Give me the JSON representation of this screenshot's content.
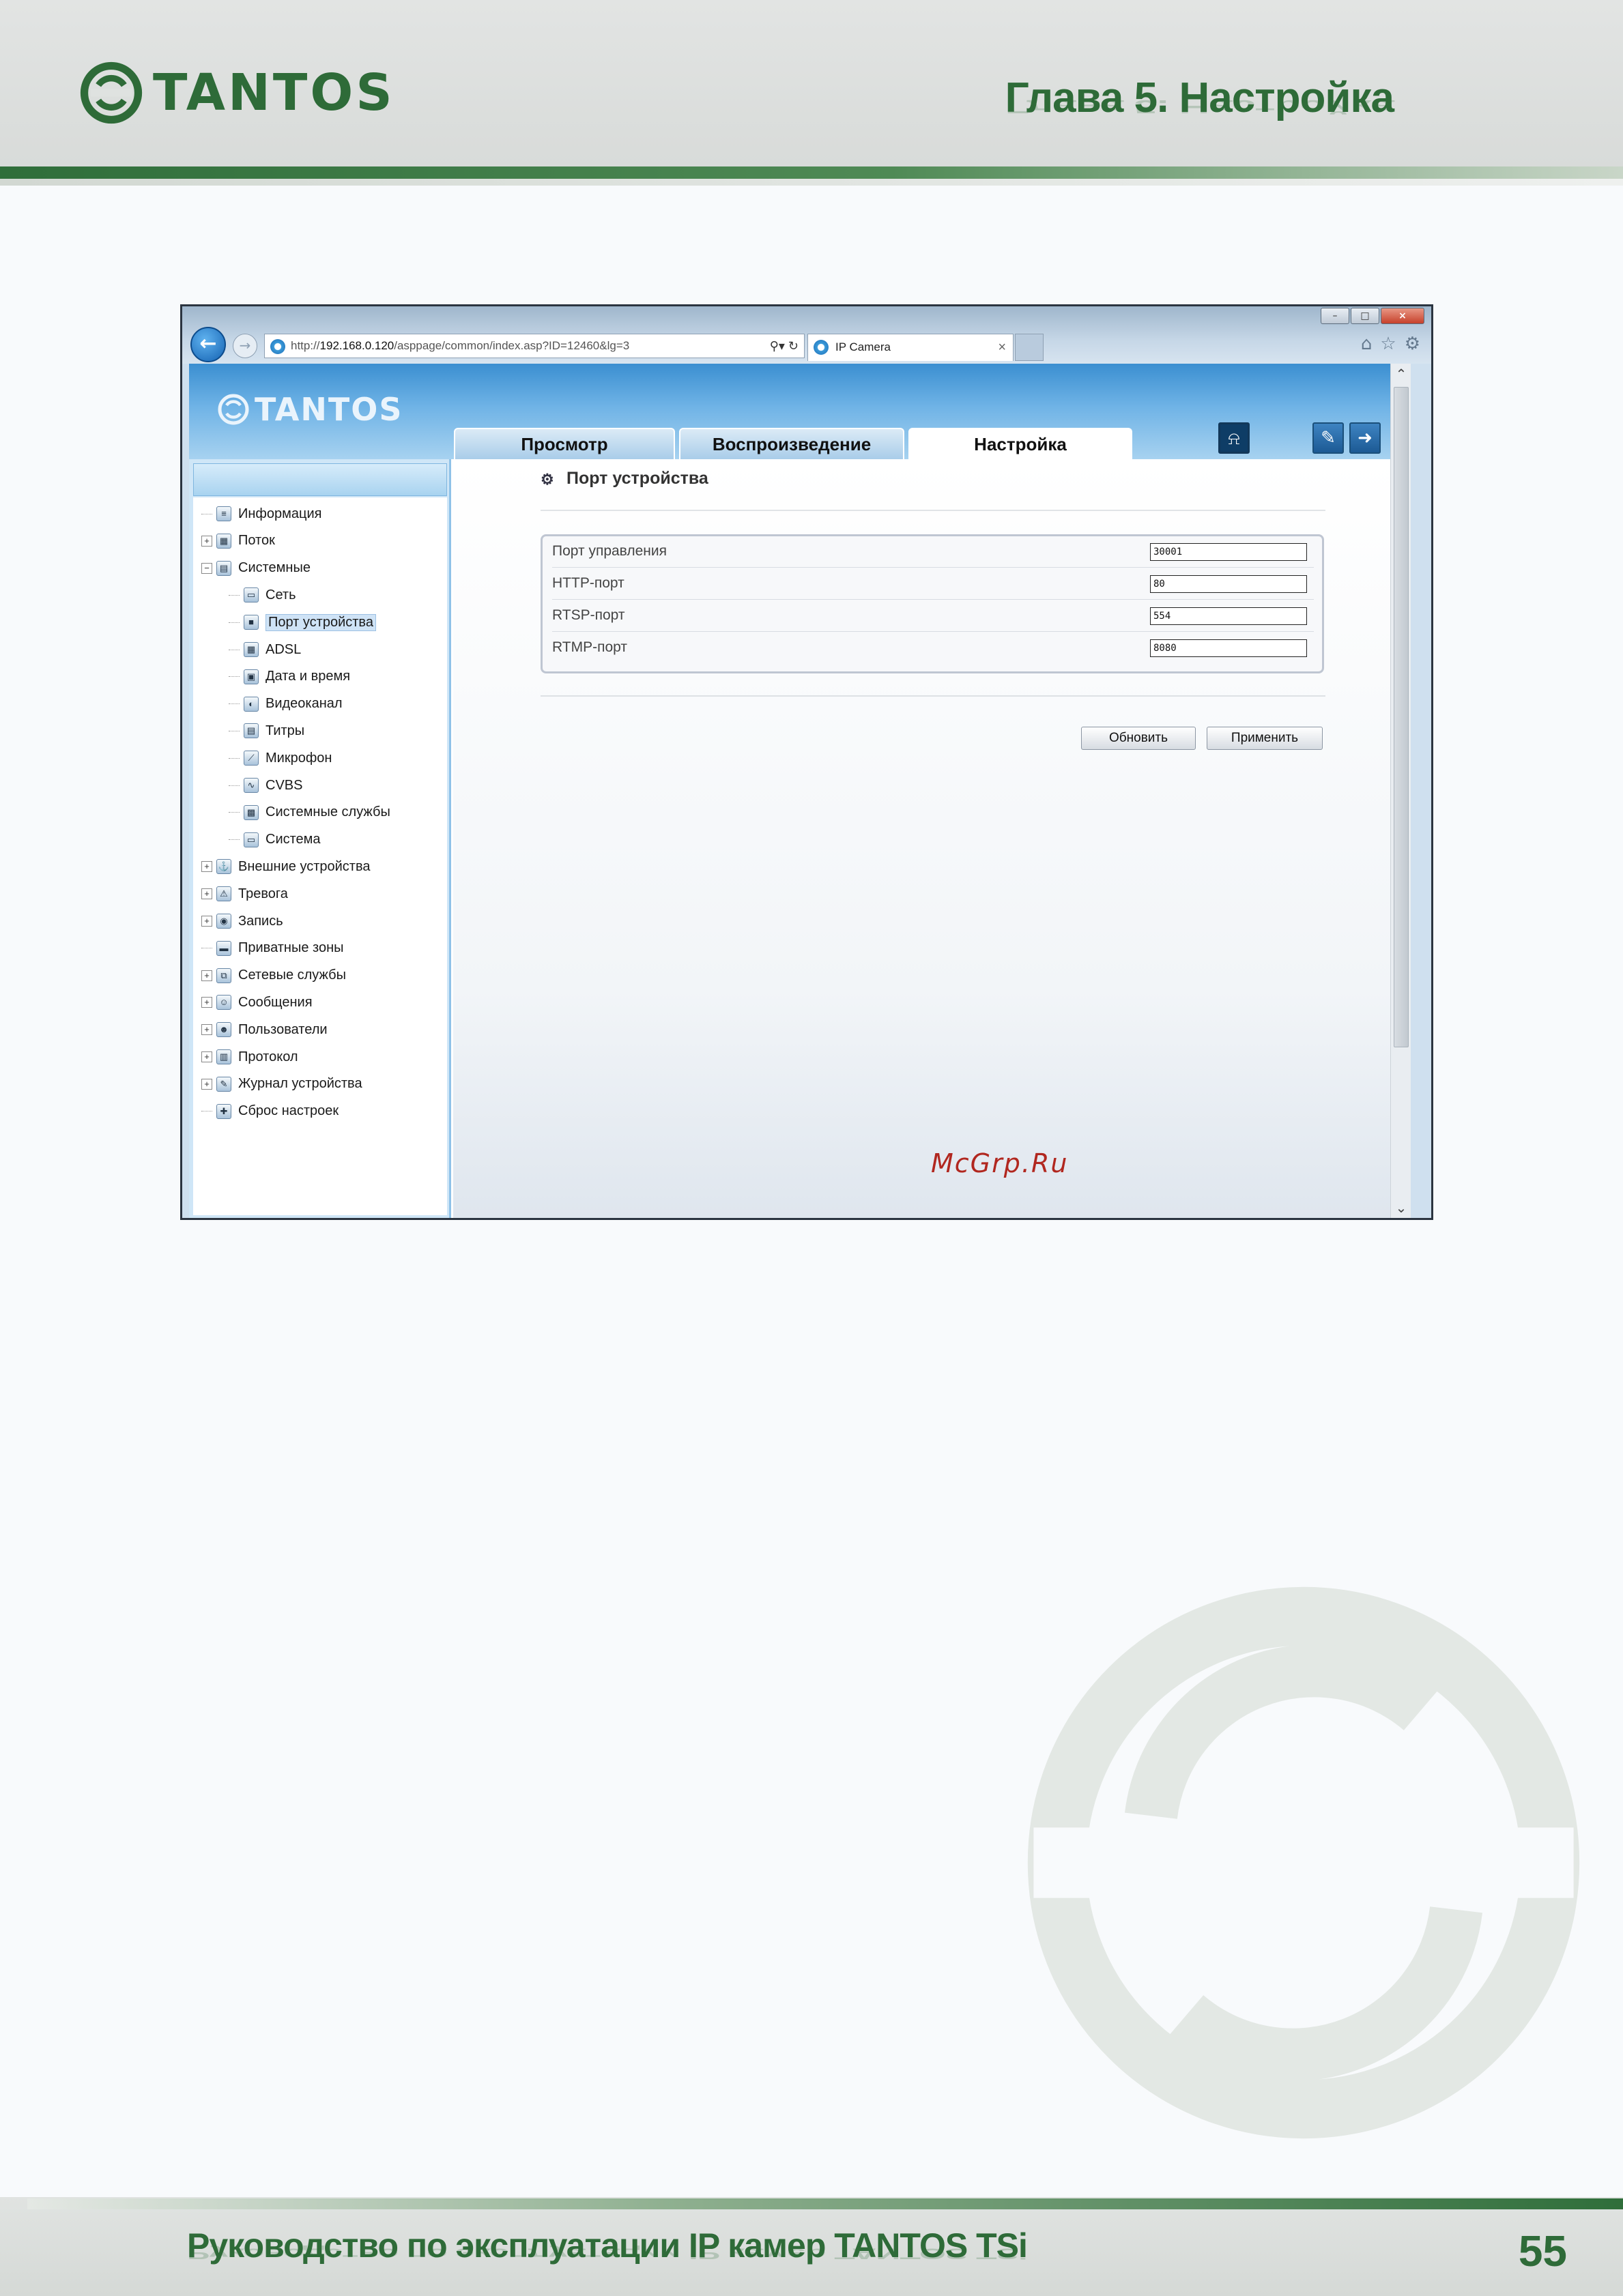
{
  "manual": {
    "brand": "TANTOS",
    "chapter_title": "Глава 5. Настройка",
    "footer_title": "Руководство по эксплуатации IP камер TANTOS TSi",
    "page_number": "55",
    "accent_color": "#2e6b38"
  },
  "browser": {
    "address_prefix": "http://",
    "address_host": "192.168.0.120",
    "address_path": "/asppage/common/index.asp?ID=12460&lg=3",
    "tab_title": "IP Camera",
    "tab_close": "×",
    "window_controls": [
      "–",
      "□",
      "×"
    ],
    "toolbar_icons": [
      "home-icon",
      "star-icon",
      "gear-icon"
    ]
  },
  "camera_ui": {
    "logo": "TANTOS",
    "tabs": [
      {
        "label": "Просмотр",
        "active": false
      },
      {
        "label": "Воспроизведение",
        "active": false
      },
      {
        "label": "Настройка",
        "active": true
      }
    ],
    "sidebar": {
      "items": [
        {
          "label": "Информация",
          "level": 0,
          "expander": "",
          "icon": "info-icon"
        },
        {
          "label": "Поток",
          "level": 0,
          "expander": "+",
          "icon": "stream-icon"
        },
        {
          "label": "Системные",
          "level": 0,
          "expander": "−",
          "icon": "system-folder-icon"
        },
        {
          "label": "Сеть",
          "level": 1,
          "expander": "",
          "icon": "network-icon"
        },
        {
          "label": "Порт устройства",
          "level": 1,
          "expander": "",
          "icon": "port-icon",
          "selected": true
        },
        {
          "label": "ADSL",
          "level": 1,
          "expander": "",
          "icon": "adsl-icon"
        },
        {
          "label": "Дата и время",
          "level": 1,
          "expander": "",
          "icon": "calendar-icon"
        },
        {
          "label": "Видеоканал",
          "level": 1,
          "expander": "",
          "icon": "camera-icon"
        },
        {
          "label": "Титры",
          "level": 1,
          "expander": "",
          "icon": "titles-icon"
        },
        {
          "label": "Микрофон",
          "level": 1,
          "expander": "",
          "icon": "microphone-icon"
        },
        {
          "label": "CVBS",
          "level": 1,
          "expander": "",
          "icon": "cvbs-icon"
        },
        {
          "label": "Системные службы",
          "level": 1,
          "expander": "",
          "icon": "services-icon"
        },
        {
          "label": "Система",
          "level": 1,
          "expander": "",
          "icon": "computer-icon"
        },
        {
          "label": "Внешние устройства",
          "level": 0,
          "expander": "+",
          "icon": "external-devices-icon"
        },
        {
          "label": "Тревога",
          "level": 0,
          "expander": "+",
          "icon": "alarm-icon"
        },
        {
          "label": "Запись",
          "level": 0,
          "expander": "+",
          "icon": "record-icon"
        },
        {
          "label": "Приватные зоны",
          "level": 0,
          "expander": "",
          "icon": "privacy-zone-icon"
        },
        {
          "label": "Сетевые службы",
          "level": 0,
          "expander": "+",
          "icon": "network-services-icon"
        },
        {
          "label": "Сообщения",
          "level": 0,
          "expander": "+",
          "icon": "messages-icon"
        },
        {
          "label": "Пользователи",
          "level": 0,
          "expander": "+",
          "icon": "users-icon"
        },
        {
          "label": "Протокол",
          "level": 0,
          "expander": "+",
          "icon": "protocol-icon"
        },
        {
          "label": "Журнал устройства",
          "level": 0,
          "expander": "+",
          "icon": "log-icon"
        },
        {
          "label": "Сброс настроек",
          "level": 0,
          "expander": "",
          "icon": "reset-icon"
        }
      ]
    },
    "content": {
      "title": "Порт устройства",
      "ports": [
        {
          "label": "Порт управления",
          "value": "30001"
        },
        {
          "label": "HTTP-порт",
          "value": "80"
        },
        {
          "label": "RTSP-порт",
          "value": "554"
        },
        {
          "label": "RTMP-порт",
          "value": "8080"
        }
      ],
      "refresh_label": "Обновить",
      "apply_label": "Применить",
      "watermark": "McGrp.Ru"
    }
  }
}
